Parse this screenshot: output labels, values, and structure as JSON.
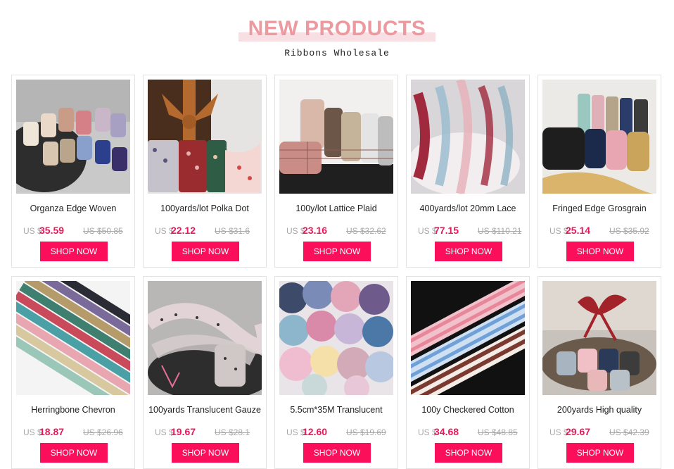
{
  "header": {
    "title": "NEW PRODUCTS",
    "subtitle": "Ribbons Wholesale"
  },
  "colors": {
    "accent": "#fb0f5b",
    "price": "#e8195b",
    "title": "#ec9aa0",
    "title_highlight": "#f7dfe3"
  },
  "products": [
    {
      "name": "Organza Edge Woven",
      "currency": "US $",
      "price": "35.59",
      "old_price": "US $50.85",
      "cta": "SHOP NOW",
      "image": "organza-edge-woven-ribbon-photo"
    },
    {
      "name": "100yards/lot Polka Dot",
      "currency": "US $",
      "price": "22.12",
      "old_price": "US $31.6",
      "cta": "SHOP NOW",
      "image": "polka-dot-ribbon-photo"
    },
    {
      "name": "100y/lot Lattice Plaid",
      "currency": "US $",
      "price": "23.16",
      "old_price": "US $32.62",
      "cta": "SHOP NOW",
      "image": "lattice-plaid-ribbon-photo"
    },
    {
      "name": "400yards/lot 20mm Lace",
      "currency": "US $",
      "price": "77.15",
      "old_price": "US $110.21",
      "cta": "SHOP NOW",
      "image": "lace-ribbon-photo"
    },
    {
      "name": "Fringed Edge Grosgrain",
      "currency": "US $",
      "price": "25.14",
      "old_price": "US $35.92",
      "cta": "SHOP NOW",
      "image": "fringed-grosgrain-ribbon-photo"
    },
    {
      "name": "Herringbone Chevron",
      "currency": "US $",
      "price": "18.87",
      "old_price": "US $26.96",
      "cta": "SHOP NOW",
      "image": "herringbone-chevron-ribbon-photo"
    },
    {
      "name": "100yards Translucent Gauze",
      "currency": "US $",
      "price": "19.67",
      "old_price": "US $28.1",
      "cta": "SHOP NOW",
      "image": "translucent-gauze-ribbon-photo"
    },
    {
      "name": "5.5cm*35M Translucent",
      "currency": "US $",
      "price": "12.60",
      "old_price": "US $19.69",
      "cta": "SHOP NOW",
      "image": "translucent-organza-rolls-photo"
    },
    {
      "name": "100y Checkered Cotton",
      "currency": "US $",
      "price": "34.68",
      "old_price": "US $48.85",
      "cta": "SHOP NOW",
      "image": "checkered-cotton-ribbon-photo"
    },
    {
      "name": "200yards High quality",
      "currency": "US $",
      "price": "29.67",
      "old_price": "US $42.39",
      "cta": "SHOP NOW",
      "image": "high-quality-ribbon-bow-photo"
    }
  ]
}
